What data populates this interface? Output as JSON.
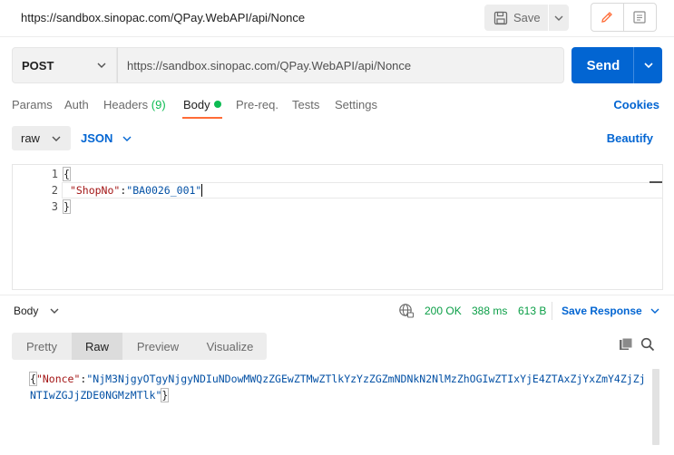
{
  "titlebar": {
    "url": "https://sandbox.sinopac.com/QPay.WebAPI/api/Nonce",
    "save_label": "Save"
  },
  "request": {
    "method": "POST",
    "url": "https://sandbox.sinopac.com/QPay.WebAPI/api/Nonce",
    "send_label": "Send"
  },
  "tabs": {
    "params": "Params",
    "auth": "Auth",
    "headers": "Headers",
    "headers_count": "(9)",
    "body": "Body",
    "prereq": "Pre-req.",
    "tests": "Tests",
    "settings": "Settings",
    "cookies": "Cookies"
  },
  "body_options": {
    "mode": "raw",
    "language": "JSON",
    "beautify": "Beautify"
  },
  "editor": {
    "line_numbers": [
      "1",
      "2",
      "3"
    ],
    "open_brace": "{",
    "key": "\"ShopNo\"",
    "colon": ":",
    "value": "\"BA0026_001\"",
    "close_brace": "}"
  },
  "response": {
    "body_label": "Body",
    "status": "200 OK",
    "time": "388 ms",
    "size": "613 B",
    "save_response": "Save Response",
    "view_tabs": [
      "Pretty",
      "Raw",
      "Preview",
      "Visualize"
    ],
    "active_view": "Raw",
    "content": {
      "open": "{",
      "key": "\"Nonce\"",
      "colon": ":",
      "value": "\"NjM3NjgyOTgyNjgyNDIuNDowMWQzZGEwZTMwZTlkYzYzZGZmNDNkN2NlMzZhOGIwZTIxYjE4ZTAxZjYxZmY4ZjZjNTIwZGJjZDE0NGMzMTlk\"",
      "close": "}"
    }
  },
  "colors": {
    "accent": "#0265d2",
    "status_green": "#0a9e46",
    "tab_indicator": "#ff6c37",
    "body_dot": "#0cbb52"
  }
}
